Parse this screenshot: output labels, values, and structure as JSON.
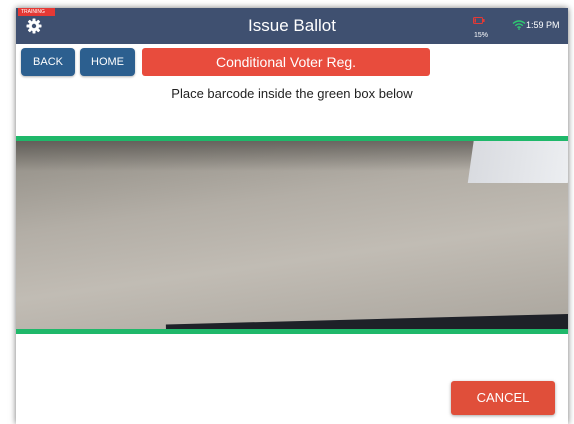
{
  "header": {
    "training_badge": "TRAINING",
    "title": "Issue Ballot",
    "battery_percent": "15%",
    "time": "1:59 PM",
    "background_color": "#3f5070",
    "icons": [
      "gear-icon",
      "battery-low-icon",
      "wifi-icon"
    ]
  },
  "nav": {
    "back_label": "BACK",
    "home_label": "HOME",
    "mode_banner": "Conditional Voter Reg."
  },
  "scanner": {
    "instruction": "Place barcode inside the green box below",
    "guide_color": "#1fb86a"
  },
  "footer": {
    "cancel_label": "CANCEL"
  },
  "colors": {
    "button_blue": "#2c5f8f",
    "banner_red": "#e84c3d",
    "cancel_red": "#e04f3a",
    "battery_red": "#e53935",
    "wifi_green": "#2ecc71"
  }
}
